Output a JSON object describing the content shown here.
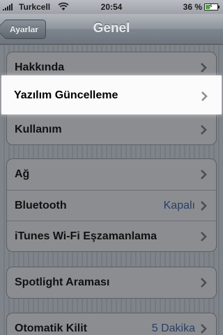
{
  "status_bar": {
    "carrier": "Turkcell",
    "time": "20:54",
    "battery_percent": "36 %",
    "signal_bars": 5,
    "charging": true
  },
  "nav_bar": {
    "back_label": "Ayarlar",
    "title": "Genel"
  },
  "groups": [
    {
      "rows": [
        {
          "label": "Hakkında",
          "value": ""
        },
        {
          "label": "Yazılım Güncelleme",
          "value": "",
          "highlighted": true
        },
        {
          "label": "Kullanım",
          "value": ""
        }
      ]
    },
    {
      "rows": [
        {
          "label": "Ağ",
          "value": ""
        },
        {
          "label": "Bluetooth",
          "value": "Kapalı"
        },
        {
          "label": "iTunes Wi-Fi Eşzamanlama",
          "value": ""
        }
      ]
    },
    {
      "rows": [
        {
          "label": "Spotlight Araması",
          "value": ""
        }
      ]
    },
    {
      "rows": [
        {
          "label": "Otomatik Kilit",
          "value": "5 Dakika"
        }
      ]
    }
  ],
  "icons": {
    "row_disclosure": "chevron-right-icon",
    "wifi": "wifi-icon",
    "battery": "battery-charging-icon"
  },
  "colors": {
    "value_text": "#2c3f63",
    "dim_overlay": "#8b8d91",
    "highlight": "#ffffff"
  }
}
